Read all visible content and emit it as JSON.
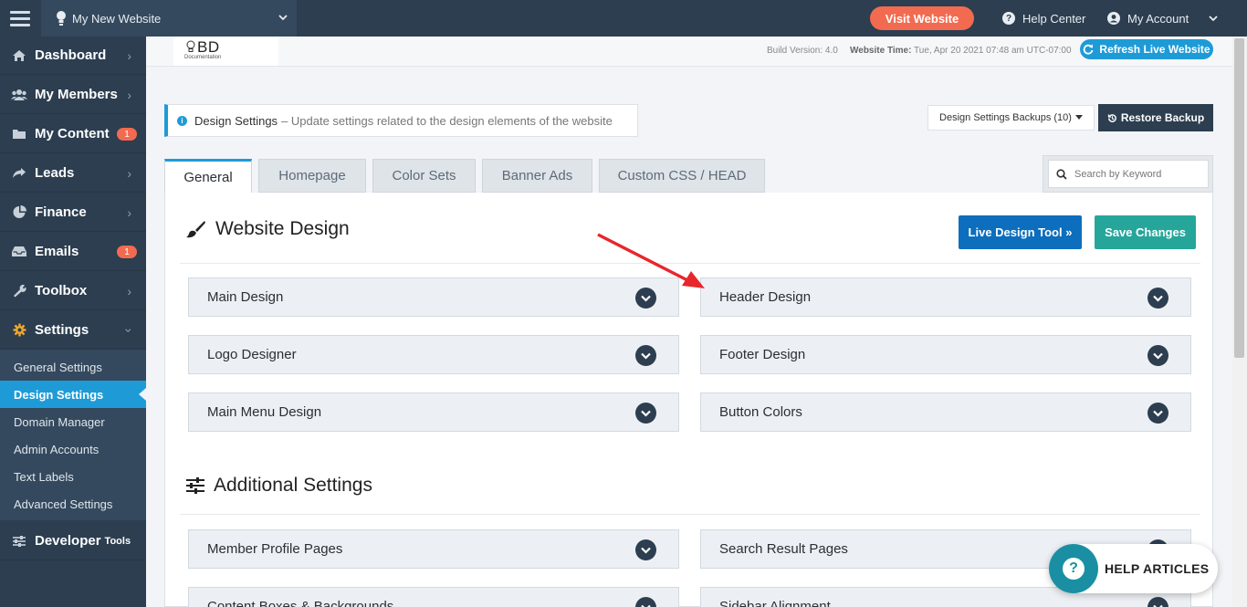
{
  "topbar": {
    "site_name": "My New Website",
    "visit_label": "Visit Website",
    "help_label": "Help Center",
    "account_label": "My Account"
  },
  "sidebar": {
    "items": [
      {
        "label": "Dashboard",
        "icon": "home-icon"
      },
      {
        "label": "My Members",
        "icon": "users-icon"
      },
      {
        "label": "My Content",
        "icon": "folder-icon",
        "badge": "1"
      },
      {
        "label": "Leads",
        "icon": "share-icon"
      },
      {
        "label": "Finance",
        "icon": "pie-chart-icon"
      },
      {
        "label": "Emails",
        "icon": "inbox-icon",
        "badge": "1"
      },
      {
        "label": "Toolbox",
        "icon": "wrench-icon"
      },
      {
        "label": "Settings",
        "icon": "gear-icon"
      }
    ],
    "sub_items": [
      "General Settings",
      "Design Settings",
      "Domain Manager",
      "Admin Accounts",
      "Text Labels",
      "Advanced Settings"
    ],
    "developer": {
      "label": "Developer",
      "small": "Tools"
    }
  },
  "infobar": {
    "logo_text": "BD",
    "logo_sub": "Documentation",
    "build": "Build Version: 4.0",
    "time_label": "Website Time:",
    "time_value": "Tue, Apr 20 2021 07:48 am UTC-07:00",
    "refresh_label": "Refresh Live Website"
  },
  "heading": {
    "title": "Design Settings",
    "description": "– Update settings related to the design elements of the website",
    "backups_label": "Design Settings Backups (10)",
    "restore_label": "Restore Backup"
  },
  "tabs": [
    "General",
    "Homepage",
    "Color Sets",
    "Banner Ads",
    "Custom CSS / HEAD"
  ],
  "search": {
    "placeholder": "Search by Keyword"
  },
  "website_design": {
    "title": "Website Design",
    "live_tool_label": "Live Design Tool »",
    "save_label": "Save Changes",
    "sections": [
      "Main Design",
      "Header Design",
      "Logo Designer",
      "Footer Design",
      "Main Menu Design",
      "Button Colors"
    ]
  },
  "additional": {
    "title": "Additional Settings",
    "sections": [
      "Member Profile Pages",
      "Search Result Pages",
      "Content Boxes & Backgrounds",
      "Sidebar Alignment"
    ]
  },
  "help_articles": {
    "label": "HELP ARTICLES"
  },
  "colors": {
    "accent": "#1e9bd7",
    "sidebar": "#2c3e50",
    "visit": "#f26b50",
    "save": "#26a69a",
    "arrow": "#e8262b"
  }
}
